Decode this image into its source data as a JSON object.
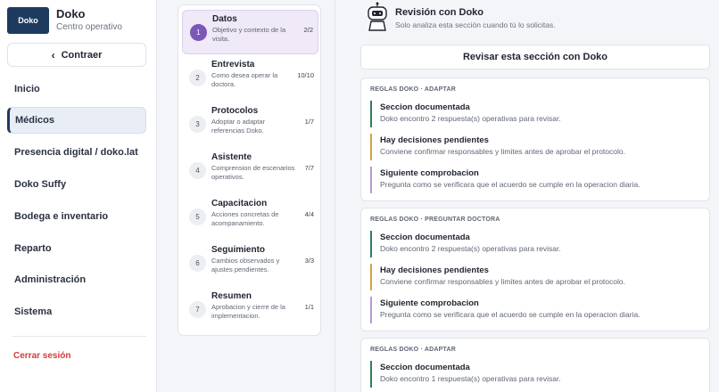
{
  "brand": {
    "logo_text": "Doko",
    "name": "Doko",
    "subtitle": "Centro operativo"
  },
  "sidebar": {
    "collapse_label": "Contraer",
    "items": [
      {
        "label": "Inicio"
      },
      {
        "label": "Médicos"
      },
      {
        "label": "Presencia digital / doko.lat"
      },
      {
        "label": "Doko Suffy"
      },
      {
        "label": "Bodega e inventario"
      },
      {
        "label": "Reparto"
      },
      {
        "label": "Administración"
      },
      {
        "label": "Sistema"
      }
    ],
    "active_item": "Médicos",
    "logout_label": "Cerrar sesión"
  },
  "steps": [
    {
      "num": "1",
      "title": "Datos",
      "desc": "Objetivo y contexto de la visita.",
      "count": "2/2"
    },
    {
      "num": "2",
      "title": "Entrevista",
      "desc": "Como desea operar la doctora.",
      "count": "10/10"
    },
    {
      "num": "3",
      "title": "Protocolos",
      "desc": "Adoptar o adaptar referencias Doko.",
      "count": "1/7"
    },
    {
      "num": "4",
      "title": "Asistente",
      "desc": "Comprension de escenarios operativos.",
      "count": "7/7"
    },
    {
      "num": "5",
      "title": "Capacitacion",
      "desc": "Acciones concretas de acompanamiento.",
      "count": "4/4"
    },
    {
      "num": "6",
      "title": "Seguimiento",
      "desc": "Cambios observados y ajustes pendientes.",
      "count": "3/3"
    },
    {
      "num": "7",
      "title": "Resumen",
      "desc": "Aprobacion y cierre de la implementacion.",
      "count": "1/1"
    }
  ],
  "review": {
    "title": "Revisión con Doko",
    "subtitle": "Solo analiza esta sección cuando tú lo solicitas.",
    "button_label": "Revisar esta sección con Doko"
  },
  "cards": [
    {
      "label": "REGLAS DOKO · ADAPTAR",
      "rules": [
        {
          "title": "Seccion documentada",
          "text": "Doko encontro 2 respuesta(s) operativas para revisar.",
          "color": "#2f7f5e"
        },
        {
          "title": "Hay decisiones pendientes",
          "text": "Conviene confirmar responsables y limites antes de aprobar el protocolo.",
          "color": "#d6a23e"
        },
        {
          "title": "Siguiente comprobacion",
          "text": "Pregunta como se verificara que el acuerdo se cumple en la operacion diaria.",
          "color": "#b39ad8"
        }
      ]
    },
    {
      "label": "REGLAS DOKO · PREGUNTAR DOCTORA",
      "rules": [
        {
          "title": "Seccion documentada",
          "text": "Doko encontro 2 respuesta(s) operativas para revisar.",
          "color": "#2f7f5e"
        },
        {
          "title": "Hay decisiones pendientes",
          "text": "Conviene confirmar responsables y limites antes de aprobar el protocolo.",
          "color": "#d6a23e"
        },
        {
          "title": "Siguiente comprobacion",
          "text": "Pregunta como se verificara que el acuerdo se cumple en la operacion diaria.",
          "color": "#b39ad8"
        }
      ]
    },
    {
      "label": "REGLAS DOKO · ADAPTAR",
      "rules": [
        {
          "title": "Seccion documentada",
          "text": "Doko encontro 1 respuesta(s) operativas para revisar.",
          "color": "#2f7f5e"
        }
      ]
    }
  ]
}
